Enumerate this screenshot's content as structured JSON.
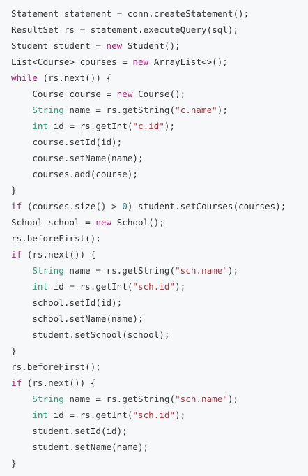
{
  "colors": {
    "background": "#f6f8fa",
    "plain": "#333333",
    "keyword": "#b4217b",
    "string": "#b7323a",
    "type": "#2d9c6f",
    "number": "#20757a"
  },
  "code": {
    "lines": [
      [
        {
          "t": "Statement statement = conn.createStatement();",
          "k": "plain"
        }
      ],
      [
        {
          "t": "ResultSet rs = statement.executeQuery(sql);",
          "k": "plain"
        }
      ],
      [
        {
          "t": "Student student = ",
          "k": "plain"
        },
        {
          "t": "new",
          "k": "kw"
        },
        {
          "t": " Student();",
          "k": "plain"
        }
      ],
      [
        {
          "t": "List<Course> courses = ",
          "k": "plain"
        },
        {
          "t": "new",
          "k": "kw"
        },
        {
          "t": " ArrayList<>();",
          "k": "plain"
        }
      ],
      [
        {
          "t": "while",
          "k": "kw"
        },
        {
          "t": " (rs.next()) {",
          "k": "plain"
        }
      ],
      [
        {
          "t": "    Course course = ",
          "k": "plain"
        },
        {
          "t": "new",
          "k": "kw"
        },
        {
          "t": " Course();",
          "k": "plain"
        }
      ],
      [
        {
          "t": "    ",
          "k": "plain"
        },
        {
          "t": "String",
          "k": "type"
        },
        {
          "t": " name = rs.getString(",
          "k": "plain"
        },
        {
          "t": "\"c.name\"",
          "k": "str"
        },
        {
          "t": ");",
          "k": "plain"
        }
      ],
      [
        {
          "t": "    ",
          "k": "plain"
        },
        {
          "t": "int",
          "k": "type"
        },
        {
          "t": " id = rs.getInt(",
          "k": "plain"
        },
        {
          "t": "\"c.id\"",
          "k": "str"
        },
        {
          "t": ");",
          "k": "plain"
        }
      ],
      [
        {
          "t": "    course.setId(id);",
          "k": "plain"
        }
      ],
      [
        {
          "t": "    course.setName(name);",
          "k": "plain"
        }
      ],
      [
        {
          "t": "    courses.add(course);",
          "k": "plain"
        }
      ],
      [
        {
          "t": "}",
          "k": "plain"
        }
      ],
      [
        {
          "t": "if",
          "k": "kw"
        },
        {
          "t": " (courses.size() > ",
          "k": "plain"
        },
        {
          "t": "0",
          "k": "num"
        },
        {
          "t": ") student.setCourses(courses);",
          "k": "plain"
        }
      ],
      [
        {
          "t": "School school = ",
          "k": "plain"
        },
        {
          "t": "new",
          "k": "kw"
        },
        {
          "t": " School();",
          "k": "plain"
        }
      ],
      [
        {
          "t": "rs.beforeFirst();",
          "k": "plain"
        }
      ],
      [
        {
          "t": "if",
          "k": "kw"
        },
        {
          "t": " (rs.next()) {",
          "k": "plain"
        }
      ],
      [
        {
          "t": "    ",
          "k": "plain"
        },
        {
          "t": "String",
          "k": "type"
        },
        {
          "t": " name = rs.getString(",
          "k": "plain"
        },
        {
          "t": "\"sch.name\"",
          "k": "str"
        },
        {
          "t": ");",
          "k": "plain"
        }
      ],
      [
        {
          "t": "    ",
          "k": "plain"
        },
        {
          "t": "int",
          "k": "type"
        },
        {
          "t": " id = rs.getInt(",
          "k": "plain"
        },
        {
          "t": "\"sch.id\"",
          "k": "str"
        },
        {
          "t": ");",
          "k": "plain"
        }
      ],
      [
        {
          "t": "    school.setId(id);",
          "k": "plain"
        }
      ],
      [
        {
          "t": "    school.setName(name);",
          "k": "plain"
        }
      ],
      [
        {
          "t": "    student.setSchool(school);",
          "k": "plain"
        }
      ],
      [
        {
          "t": "}",
          "k": "plain"
        }
      ],
      [
        {
          "t": "rs.beforeFirst();",
          "k": "plain"
        }
      ],
      [
        {
          "t": "if",
          "k": "kw"
        },
        {
          "t": " (rs.next()) {",
          "k": "plain"
        }
      ],
      [
        {
          "t": "    ",
          "k": "plain"
        },
        {
          "t": "String",
          "k": "type"
        },
        {
          "t": " name = rs.getString(",
          "k": "plain"
        },
        {
          "t": "\"sch.name\"",
          "k": "str"
        },
        {
          "t": ");",
          "k": "plain"
        }
      ],
      [
        {
          "t": "    ",
          "k": "plain"
        },
        {
          "t": "int",
          "k": "type"
        },
        {
          "t": " id = rs.getInt(",
          "k": "plain"
        },
        {
          "t": "\"sch.id\"",
          "k": "str"
        },
        {
          "t": ");",
          "k": "plain"
        }
      ],
      [
        {
          "t": "    student.setId(id);",
          "k": "plain"
        }
      ],
      [
        {
          "t": "    student.setName(name);",
          "k": "plain"
        }
      ],
      [
        {
          "t": "}",
          "k": "plain"
        }
      ]
    ]
  }
}
